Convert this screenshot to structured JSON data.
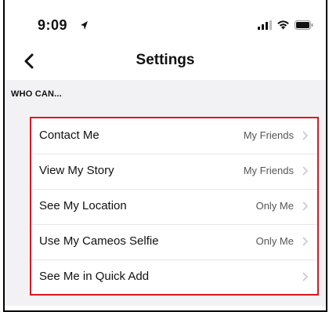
{
  "status_bar": {
    "time": "9:09",
    "location_icon": "location-arrow-icon",
    "signal_icon": "cellular-signal-icon",
    "wifi_icon": "wifi-icon",
    "battery_icon": "battery-icon"
  },
  "nav": {
    "back_icon": "chevron-left-icon",
    "title": "Settings"
  },
  "section": {
    "header": "WHO CAN..."
  },
  "rows": [
    {
      "label": "Contact Me",
      "value": "My Friends"
    },
    {
      "label": "View My Story",
      "value": "My Friends"
    },
    {
      "label": "See My Location",
      "value": "Only Me"
    },
    {
      "label": "Use My Cameos Selfie",
      "value": "Only Me"
    },
    {
      "label": "See Me in Quick Add",
      "value": ""
    }
  ],
  "colors": {
    "highlight_border": "#e0161e",
    "section_bg": "#f2f2f4"
  }
}
